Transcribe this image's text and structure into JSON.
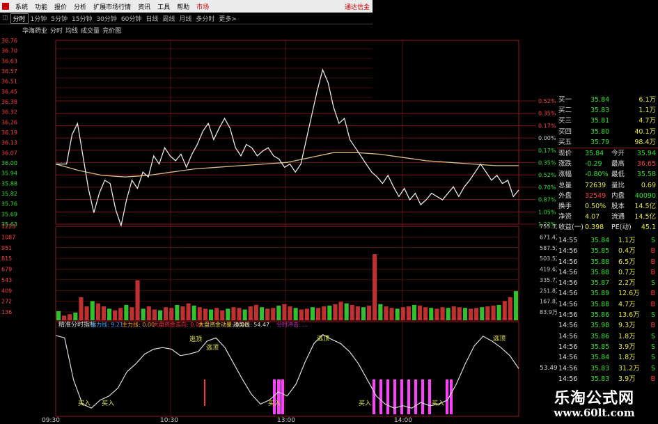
{
  "menu": {
    "items": [
      "系统",
      "功能",
      "报价",
      "分析",
      "扩展市场行情",
      "资讯",
      "工具",
      "帮助"
    ],
    "market": "市场",
    "broker": "通达信金"
  },
  "periods": [
    "分时",
    "1分钟",
    "5分钟",
    "15分钟",
    "30分钟",
    "60分钟",
    "日线",
    "周线",
    "月线",
    "多分时",
    "更多>"
  ],
  "stock_line": {
    "name": "华海药业",
    "tabs": [
      "分时",
      "均线",
      "成交量",
      "竞价图"
    ]
  },
  "price_axis": {
    "left": [
      "36.76",
      "36.70",
      "36.63",
      "36.57",
      "36.51",
      "36.45",
      "36.38",
      "36.32",
      "36.26",
      "36.19",
      "36.13",
      "36.07",
      "36.00",
      "35.94",
      "35.88",
      "35.82",
      "35.76",
      "35.69",
      "35.63"
    ],
    "right": [
      "0.52%",
      "0.35%",
      "0.17%",
      "0.00%",
      "0.17%",
      "0.35%",
      "0.52%",
      "0.70%",
      "0.87%",
      "1.05%",
      "1.22%"
    ]
  },
  "volume_axis": {
    "left": [
      "1223",
      "1087",
      "951",
      "815",
      "679",
      "543",
      "409",
      "272",
      "136"
    ],
    "right": [
      "755.3万",
      "671.4万",
      "587.5万",
      "503.5万",
      "419.6万",
      "335.7万",
      "251.8万",
      "167.8万",
      "83.9万"
    ]
  },
  "indicator": {
    "title": "精准分时指标",
    "fields": [
      {
        "label": "主力线: 9.21",
        "color": "#2aa0ff"
      },
      {
        "label": "主力线: 0.00",
        "color": "#ffa020"
      },
      {
        "label": "大盘资金走向: 0.00",
        "color": "#ff3040"
      },
      {
        "label": "大盘资金动量: 0.00",
        "color": "#ffd840"
      },
      {
        "label": "趋势线: 54.47",
        "color": "#dddddd"
      },
      {
        "label": "分时冲击: ...",
        "color": "#c030c0"
      }
    ],
    "right_value": "53.49",
    "sell_label": "逃顶",
    "buy_label": "买入"
  },
  "time_axis": [
    "09:30",
    "10:30",
    "13:00",
    "14:00"
  ],
  "quote": {
    "bids": [
      {
        "label": "买一",
        "price": "35.84",
        "vol": "6.1万"
      },
      {
        "label": "买二",
        "price": "35.83",
        "vol": "1.1万"
      },
      {
        "label": "买三",
        "price": "35.81",
        "vol": "4.7万"
      },
      {
        "label": "买四",
        "price": "35.80",
        "vol": "40.1万"
      },
      {
        "label": "买五",
        "price": "35.79",
        "vol": "98.4万"
      }
    ],
    "stats": [
      {
        "l1": "现价",
        "v1": "35.84",
        "l2": "今开",
        "v2": "35.94",
        "c1": "#30e030",
        "c2": "#30e030"
      },
      {
        "l1": "涨跌",
        "v1": "-0.29",
        "l2": "最高",
        "v2": "36.65",
        "c1": "#30e030",
        "c2": "#ff4040"
      },
      {
        "l1": "涨幅",
        "v1": "-0.80%",
        "l2": "最低",
        "v2": "35.58",
        "c1": "#30e030",
        "c2": "#30e030"
      },
      {
        "l1": "总量",
        "v1": "72639",
        "l2": "量比",
        "v2": "0.69",
        "c1": "#e8e838",
        "c2": "#e8e838"
      },
      {
        "l1": "外盘",
        "v1": "32549",
        "l2": "内盘",
        "v2": "40090",
        "c1": "#ff4040",
        "c2": "#30e030"
      },
      {
        "l1": "换手",
        "v1": "0.50%",
        "l2": "股本",
        "v2": "14.5亿",
        "c1": "#e8e838",
        "c2": "#e8e838"
      },
      {
        "l1": "净资",
        "v1": "4.07",
        "l2": "流通",
        "v2": "14.5亿",
        "c1": "#e8e838",
        "c2": "#e8e838"
      },
      {
        "l1": "收益(一)",
        "v1": "0.398",
        "l2": "PE(动)",
        "v2": "45.1",
        "c1": "#e8e838",
        "c2": "#e8e838"
      }
    ]
  },
  "ticks": [
    {
      "time": "14:55",
      "price": "35.84",
      "vol": "1.1万",
      "bs": "S"
    },
    {
      "time": "14:56",
      "price": "35.85",
      "vol": "0.4万",
      "bs": "B"
    },
    {
      "time": "14:56",
      "price": "35.88",
      "vol": "6.5万",
      "bs": "B"
    },
    {
      "time": "14:56",
      "price": "35.88",
      "vol": "0.7万",
      "bs": "B"
    },
    {
      "time": "14:56",
      "price": "35.87",
      "vol": "2.2万",
      "bs": "S"
    },
    {
      "time": "14:56",
      "price": "35.89",
      "vol": "12.6万",
      "bs": "B"
    },
    {
      "time": "14:56",
      "price": "35.88",
      "vol": "4.7万",
      "bs": "B"
    },
    {
      "time": "14:56",
      "price": "35.86",
      "vol": "13.6万",
      "bs": "S"
    },
    {
      "time": "14:56",
      "price": "35.98",
      "vol": "9.3万",
      "bs": "B"
    },
    {
      "time": "14:56",
      "price": "35.86",
      "vol": "1.8万",
      "bs": "S"
    },
    {
      "time": "14:56",
      "price": "35.85",
      "vol": "3.9万",
      "bs": "S"
    },
    {
      "time": "14:56",
      "price": "35.84",
      "vol": "1.8万",
      "bs": "S"
    },
    {
      "time": "14:56",
      "price": "35.83",
      "vol": "31.2万",
      "bs": "S"
    },
    {
      "time": "14:56",
      "price": "35.83",
      "vol": "3.9万",
      "bs": "B"
    },
    {
      "time": "14:56",
      "price": "35.83",
      "vol": "0.4万",
      "bs": "S"
    }
  ],
  "watermark": {
    "title": "乐淘公式网",
    "url": "www.60lt.com"
  },
  "colors": {
    "grid": "#8a1a1a",
    "price_line": "#e8e8e8",
    "avg_line": "#d8c080",
    "vol_red": "#c03030",
    "vol_green": "#30c030",
    "down": "#30e030",
    "up": "#ff4040",
    "indicator_pink": "#ff40ff"
  },
  "chart_data": [
    {
      "type": "line",
      "title": "华海药业 分时",
      "ylim": [
        35.63,
        36.76
      ],
      "series": [
        {
          "name": "分时",
          "values": [
            36.0,
            36.0,
            36.0,
            36.18,
            36.25,
            36.05,
            35.85,
            35.7,
            35.82,
            35.9,
            35.88,
            35.72,
            35.62,
            35.78,
            35.9,
            35.85,
            35.95,
            35.92,
            36.05,
            36.0,
            36.1,
            36.05,
            36.02,
            36.06,
            35.98,
            36.06,
            36.12,
            36.2,
            36.25,
            36.15,
            36.22,
            36.28,
            36.22,
            36.1,
            36.05,
            36.12,
            36.1,
            36.05,
            36.08,
            36.1,
            36.05,
            36.03,
            35.98,
            36.0,
            35.95,
            36.0,
            36.15,
            36.3,
            36.45,
            36.58,
            36.5,
            36.35,
            36.25,
            36.28,
            36.15,
            36.1,
            36.05,
            36.0,
            35.95,
            35.92,
            35.88,
            35.93,
            35.86,
            35.8,
            35.85,
            35.78,
            35.82,
            35.75,
            35.78,
            35.82,
            35.8,
            35.78,
            35.82,
            35.86,
            35.8,
            35.86,
            35.9,
            35.95,
            36.0,
            35.95,
            35.9,
            35.93,
            35.88,
            35.9,
            35.8,
            35.84
          ]
        },
        {
          "name": "均价",
          "values": [
            36.0,
            35.96,
            35.93,
            35.92,
            35.93,
            35.95,
            35.97,
            35.98,
            35.99,
            36.0,
            36.01,
            36.04,
            36.07,
            36.07,
            36.06,
            36.04,
            36.02,
            36.01,
            36.0,
            35.99,
            35.99
          ]
        }
      ]
    },
    {
      "type": "bar",
      "title": "成交量",
      "ylim": [
        0,
        1223
      ],
      "values": [
        120,
        60,
        80,
        100,
        300,
        180,
        250,
        220,
        180,
        150,
        130,
        160,
        200,
        170,
        520,
        150,
        180,
        140,
        130,
        170,
        160,
        200,
        180,
        220,
        190,
        170,
        150,
        140,
        160,
        130,
        150,
        170,
        160,
        140,
        180,
        200,
        170,
        150,
        160,
        190,
        210,
        180,
        160,
        140,
        150,
        170,
        160,
        180,
        190,
        210,
        240,
        220,
        200,
        180,
        170,
        190,
        860,
        210,
        180,
        160,
        150,
        170,
        180,
        200,
        190,
        170,
        160,
        150,
        170,
        160,
        180,
        170,
        160,
        150,
        160,
        170,
        180,
        190,
        200,
        250,
        300,
        380
      ]
    },
    {
      "type": "line",
      "title": "精准分时指标",
      "ylim": [
        0,
        100
      ],
      "series": [
        {
          "name": "趋势线",
          "values": [
            95,
            92,
            40,
            10,
            5,
            15,
            20,
            30,
            50,
            60,
            72,
            78,
            80,
            78,
            70,
            72,
            75,
            88,
            92,
            80,
            60,
            40,
            22,
            10,
            15,
            25,
            20,
            35,
            62,
            85,
            96,
            90,
            85,
            75,
            60,
            40,
            20,
            10,
            5,
            8,
            5,
            12,
            8,
            10,
            15,
            35,
            60,
            82,
            94,
            88,
            80,
            70,
            54
          ]
        }
      ]
    }
  ]
}
